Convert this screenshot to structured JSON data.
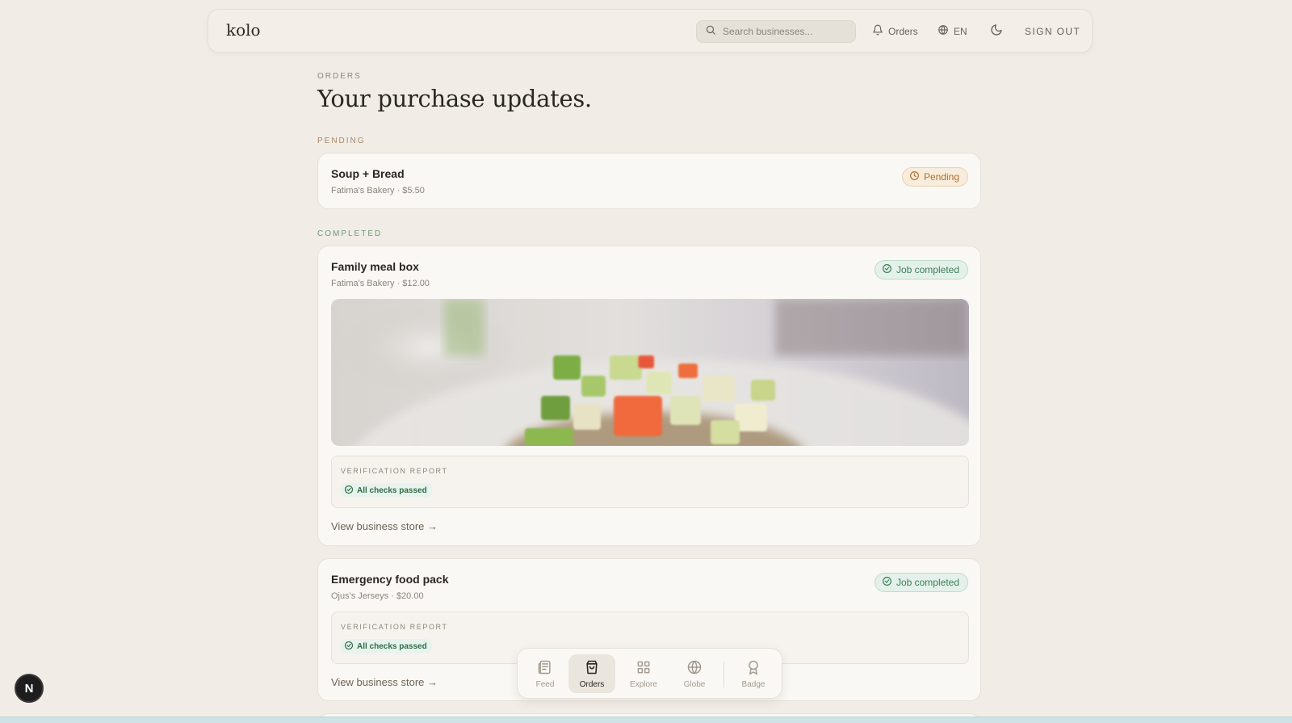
{
  "header": {
    "logo": "kolo",
    "search_placeholder": "Search businesses...",
    "orders_link": "Orders",
    "language": "EN",
    "sign_out": "SIGN OUT"
  },
  "page": {
    "eyebrow": "ORDERS",
    "title": "Your purchase updates."
  },
  "sections": {
    "pending": "PENDING",
    "completed": "COMPLETED"
  },
  "orders": [
    {
      "title": "Soup + Bread",
      "subtitle": "Fatima's Bakery · $5.50",
      "status": "Pending"
    },
    {
      "title": "Family meal box",
      "subtitle": "Fatima's Bakery · $12.00",
      "status": "Job completed",
      "report_label": "VERIFICATION REPORT",
      "report_status": "All checks passed",
      "link": "View business store →"
    },
    {
      "title": "Emergency food pack",
      "subtitle": "Ojus's Jerseys · $20.00",
      "status": "Job completed",
      "report_label": "VERIFICATION REPORT",
      "report_status": "All checks passed",
      "link": "View business store →"
    }
  ],
  "dock": {
    "items": [
      "Feed",
      "Orders",
      "Explore",
      "Globe",
      "Badge"
    ],
    "active": "Orders"
  },
  "floating_button": "N",
  "colors": {
    "background": "#f1ede6",
    "pending_accent": "#b0702e",
    "completed_accent": "#3b7d57"
  }
}
